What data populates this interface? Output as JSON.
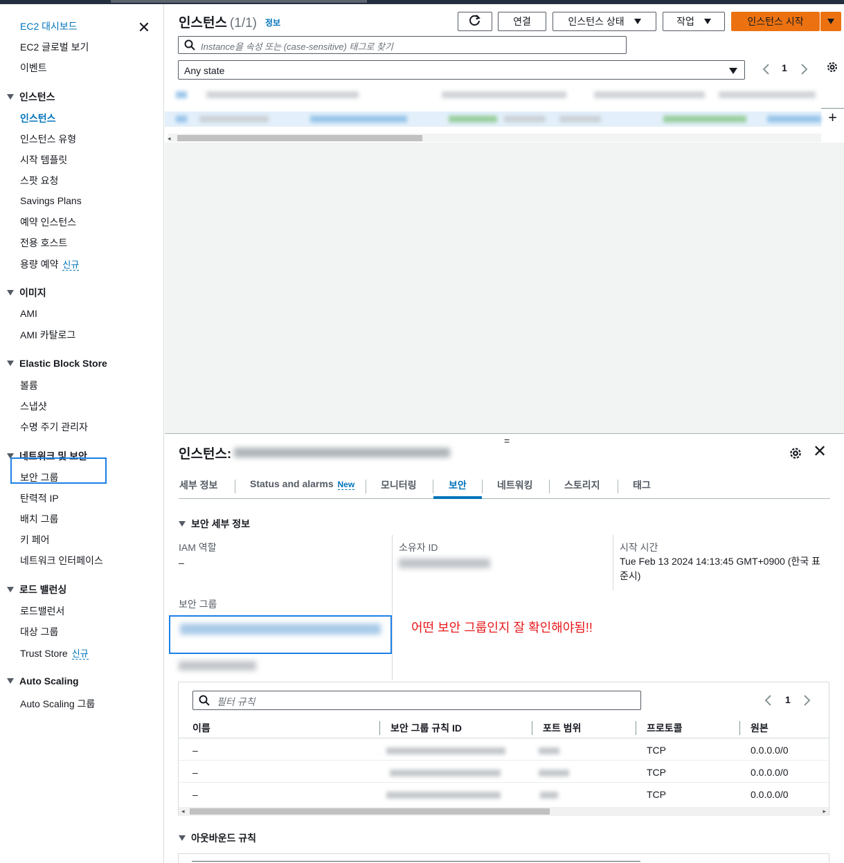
{
  "sidebar": {
    "top_items": [
      {
        "label": "EC2 대시보드"
      },
      {
        "label": "EC2 글로벌 보기"
      },
      {
        "label": "이벤트"
      }
    ],
    "sections": {
      "instances": {
        "title": "인스턴스",
        "items": [
          "인스턴스",
          "인스턴스 유형",
          "시작 템플릿",
          "스팟 요청",
          "Savings Plans",
          "예약 인스턴스",
          "전용 호스트",
          "용량 예약"
        ]
      },
      "images": {
        "title": "이미지",
        "items": [
          "AMI",
          "AMI 카탈로그"
        ]
      },
      "ebs": {
        "title": "Elastic Block Store",
        "items": [
          "볼륨",
          "스냅샷",
          "수명 주기 관리자"
        ]
      },
      "network": {
        "title": "네트워크 및 보안",
        "items": [
          "보안 그룹",
          "탄력적 IP",
          "배치 그룹",
          "키 페어",
          "네트워크 인터페이스"
        ]
      },
      "lb": {
        "title": "로드 밸런싱",
        "items": [
          "로드밸런서",
          "대상 그룹",
          "Trust Store"
        ]
      },
      "asg": {
        "title": "Auto Scaling",
        "items": [
          "Auto Scaling 그룹"
        ]
      }
    },
    "new_badge": "신규"
  },
  "header": {
    "title": "인스턴스",
    "count": "(1/1)",
    "info": "정보",
    "buttons": {
      "connect": "연결",
      "instance_state": "인스턴스 상태",
      "actions": "작업",
      "launch": "인스턴스 시작"
    },
    "search_placeholder": "Instance을 속성 또는 (case-sensitive) 태그로 찾기",
    "state_filter": "Any state",
    "page": "1"
  },
  "detail": {
    "title": "인스턴스:",
    "drag_handle": "=",
    "tabs": [
      "세부 정보",
      "Status and alarms",
      "모니터링",
      "보안",
      "네트워킹",
      "스토리지",
      "태그"
    ],
    "tab_new_badge": "New",
    "security_section": "보안 세부 정보",
    "iam_label": "IAM 역할",
    "iam_value": "–",
    "owner_label": "소유자 ID",
    "launch_label": "시작 시간",
    "launch_value": "Tue Feb 13 2024 14:13:45 GMT+0900 (한국 표준시)",
    "sg_label": "보안 그룹",
    "annotation": "어떤 보안 그룹인지 잘 확인해야됨!!",
    "rules": {
      "filter_placeholder": "필터 규칙",
      "page": "1",
      "columns": [
        "이름",
        "보안 그룹 규칙 ID",
        "포트 범위",
        "프로토콜",
        "원본"
      ],
      "rows": [
        {
          "name": "–",
          "protocol": "TCP",
          "source": "0.0.0.0/0"
        },
        {
          "name": "–",
          "protocol": "TCP",
          "source": "0.0.0.0/0"
        },
        {
          "name": "–",
          "protocol": "TCP",
          "source": "0.0.0.0/0"
        }
      ]
    },
    "outbound_section": "아웃바운드 규칙"
  },
  "colors": {
    "accent": "#0073bb",
    "primary_button": "#ec7211",
    "annotation": "#e8171a",
    "highlight_box": "#1c7fe6"
  }
}
